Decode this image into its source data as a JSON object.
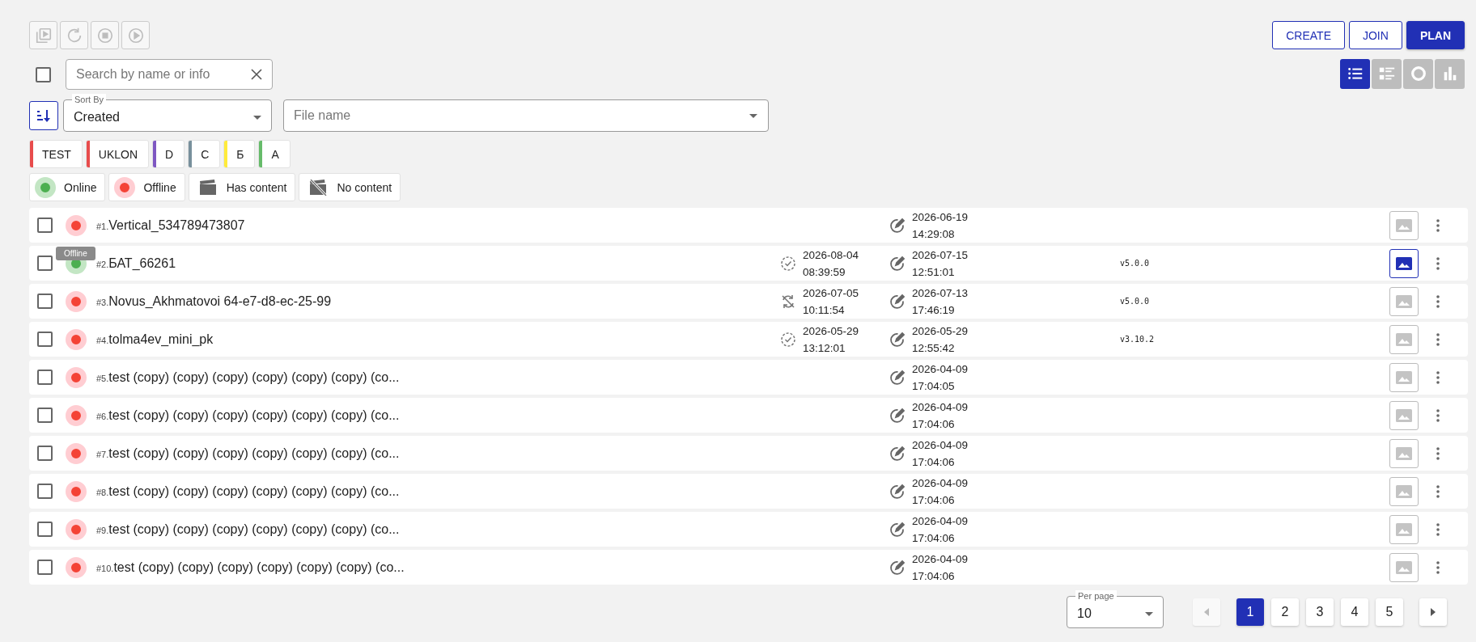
{
  "toolbar": {
    "actions": [
      {
        "kind": "playlist",
        "disabled": true
      },
      {
        "kind": "refresh",
        "disabled": true
      },
      {
        "kind": "stop",
        "disabled": true
      },
      {
        "kind": "play",
        "disabled": true
      }
    ],
    "buttons": [
      {
        "label": "CREATE",
        "kind": "outlined"
      },
      {
        "label": "JOIN",
        "kind": "outlined"
      },
      {
        "label": "PLAN",
        "kind": "filled"
      }
    ]
  },
  "select_all": {
    "checked": false
  },
  "search": {
    "placeholder": "Search by name or info"
  },
  "views": [
    {
      "kind": "list",
      "selected": true
    },
    {
      "kind": "details",
      "selected": false
    },
    {
      "kind": "donut",
      "selected": false
    },
    {
      "kind": "bars",
      "selected": false
    }
  ],
  "sort": {
    "label": "Sort By",
    "value": "Created"
  },
  "file_filter": {
    "placeholder": "File name"
  },
  "tags": [
    {
      "label": "TEST",
      "color": "#e84c4c"
    },
    {
      "label": "UKLON",
      "color": "#e84c4c"
    },
    {
      "label": "D",
      "color": "#7e57c2"
    },
    {
      "label": "C",
      "color": "#78909c"
    },
    {
      "label": "Б",
      "color": "#ffeb3b"
    },
    {
      "label": "A",
      "color": "#66bb6a"
    }
  ],
  "filters": [
    {
      "label": "Online",
      "kind": "online"
    },
    {
      "label": "Offline",
      "kind": "offline"
    },
    {
      "label": "Has content",
      "kind": "content"
    },
    {
      "label": "No content",
      "kind": "no-content"
    }
  ],
  "rows": [
    {
      "number": "#1.",
      "name": "Vertical_534789473807",
      "online": false,
      "edited_date": "2026-06-19",
      "edited_time": "14:29:08",
      "preview_selected": false,
      "checked": false
    },
    {
      "number": "#2.",
      "name": "БАТ_66261",
      "online": true,
      "tooltip": "Offline",
      "sync": {
        "kind": "synced",
        "date": "2026-08-04",
        "time": "08:39:59"
      },
      "edited_date": "2026-07-15",
      "edited_time": "12:51:01",
      "version": "v5.0.0",
      "preview_selected": true,
      "checked": false
    },
    {
      "number": "#3.",
      "name": "Novus_Akhmatovoi 64-e7-d8-ec-25-99",
      "online": false,
      "sync": {
        "kind": "unsynced",
        "date": "2026-07-05",
        "time": "10:11:54"
      },
      "edited_date": "2026-07-13",
      "edited_time": "17:46:19",
      "version": "v5.0.0",
      "preview_selected": false,
      "checked": false
    },
    {
      "number": "#4.",
      "name": "tolma4ev_mini_pk",
      "online": false,
      "sync": {
        "kind": "synced",
        "date": "2026-05-29",
        "time": "13:12:01"
      },
      "edited_date": "2026-05-29",
      "edited_time": "12:55:42",
      "version": "v3.10.2",
      "preview_selected": false,
      "checked": false
    },
    {
      "number": "#5.",
      "name": "test (copy) (copy) (copy) (copy) (copy) (copy) (co...",
      "online": false,
      "edited_date": "2026-04-09",
      "edited_time": "17:04:05",
      "preview_selected": false,
      "checked": false
    },
    {
      "number": "#6.",
      "name": "test (copy) (copy) (copy) (copy) (copy) (copy) (co...",
      "online": false,
      "edited_date": "2026-04-09",
      "edited_time": "17:04:06",
      "preview_selected": false,
      "checked": false
    },
    {
      "number": "#7.",
      "name": "test (copy) (copy) (copy) (copy) (copy) (copy) (co...",
      "online": false,
      "edited_date": "2026-04-09",
      "edited_time": "17:04:06",
      "preview_selected": false,
      "checked": false
    },
    {
      "number": "#8.",
      "name": "test (copy) (copy) (copy) (copy) (copy) (copy) (co...",
      "online": false,
      "edited_date": "2026-04-09",
      "edited_time": "17:04:06",
      "preview_selected": false,
      "checked": false
    },
    {
      "number": "#9.",
      "name": "test (copy) (copy) (copy) (copy) (copy) (copy) (co...",
      "online": false,
      "edited_date": "2026-04-09",
      "edited_time": "17:04:06",
      "preview_selected": false,
      "checked": false
    },
    {
      "number": "#10.",
      "name": "test (copy) (copy) (copy) (copy) (copy) (copy) (co...",
      "online": false,
      "edited_date": "2026-04-09",
      "edited_time": "17:04:06",
      "preview_selected": false,
      "checked": false
    }
  ],
  "per_page": {
    "label": "Per page",
    "value": "10"
  },
  "pagination": {
    "prev_disabled": true,
    "next_disabled": false,
    "pages": [
      {
        "label": "1",
        "selected": true
      },
      {
        "label": "2",
        "selected": false
      },
      {
        "label": "3",
        "selected": false
      },
      {
        "label": "4",
        "selected": false
      },
      {
        "label": "5",
        "selected": false
      }
    ]
  }
}
